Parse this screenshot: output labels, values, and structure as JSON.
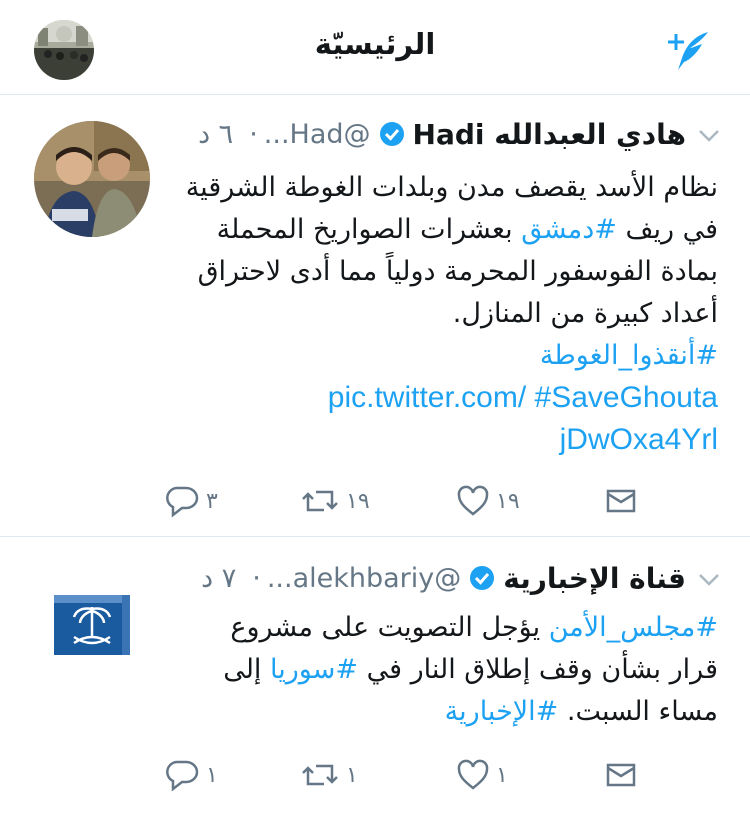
{
  "header": {
    "title": "الرئيسيّة",
    "compose_icon": "compose-tweet-icon",
    "profile_icon": "profile-photo"
  },
  "tweets": [
    {
      "name": "هادي العبدالله Hadi",
      "handle": "@Had...",
      "time": "٦ د",
      "dot": "·",
      "body_lines": [
        "نظام الأسد يقصف مدن وبلدات الغوطة الشرقية",
        "في ريف ",
        "#دمشق",
        " بعشرات الصواريخ المحملة",
        "بمادة الفوسفور المحرمة دولياً مما أدى لاحتراق",
        "أعداد كبيرة من المنازل."
      ],
      "hashtag1": "#أنقذوا_الغوطة",
      "hashtag2": "#SaveGhouta",
      "link_part1": "pic.twitter.com/",
      "link_part2": "jDwOxa4Yrl",
      "replies": "٣",
      "retweets": "١٩",
      "likes": "١٩"
    },
    {
      "name": "قناة الإخبارية",
      "handle": "@alekhbariy...",
      "time": "٧ د",
      "dot": "·",
      "line1_tag": "#مجلس_الأمن",
      "line1_text": " يؤجل التصويت على مشروع",
      "line2_text": "قرار بشأن وقف إطلاق النار في ",
      "line2_tag": "#سوريا",
      "line2_end": " إلى",
      "line3_text": "مساء السبت. ",
      "line3_tag": "#الإخبارية",
      "replies": "١",
      "retweets": "١",
      "likes": "١"
    }
  ],
  "colors": {
    "accent": "#1da1f2",
    "muted": "#657786",
    "text": "#14171a",
    "divider": "#e1e8ed",
    "logo_blue": "#1a5a9e"
  }
}
